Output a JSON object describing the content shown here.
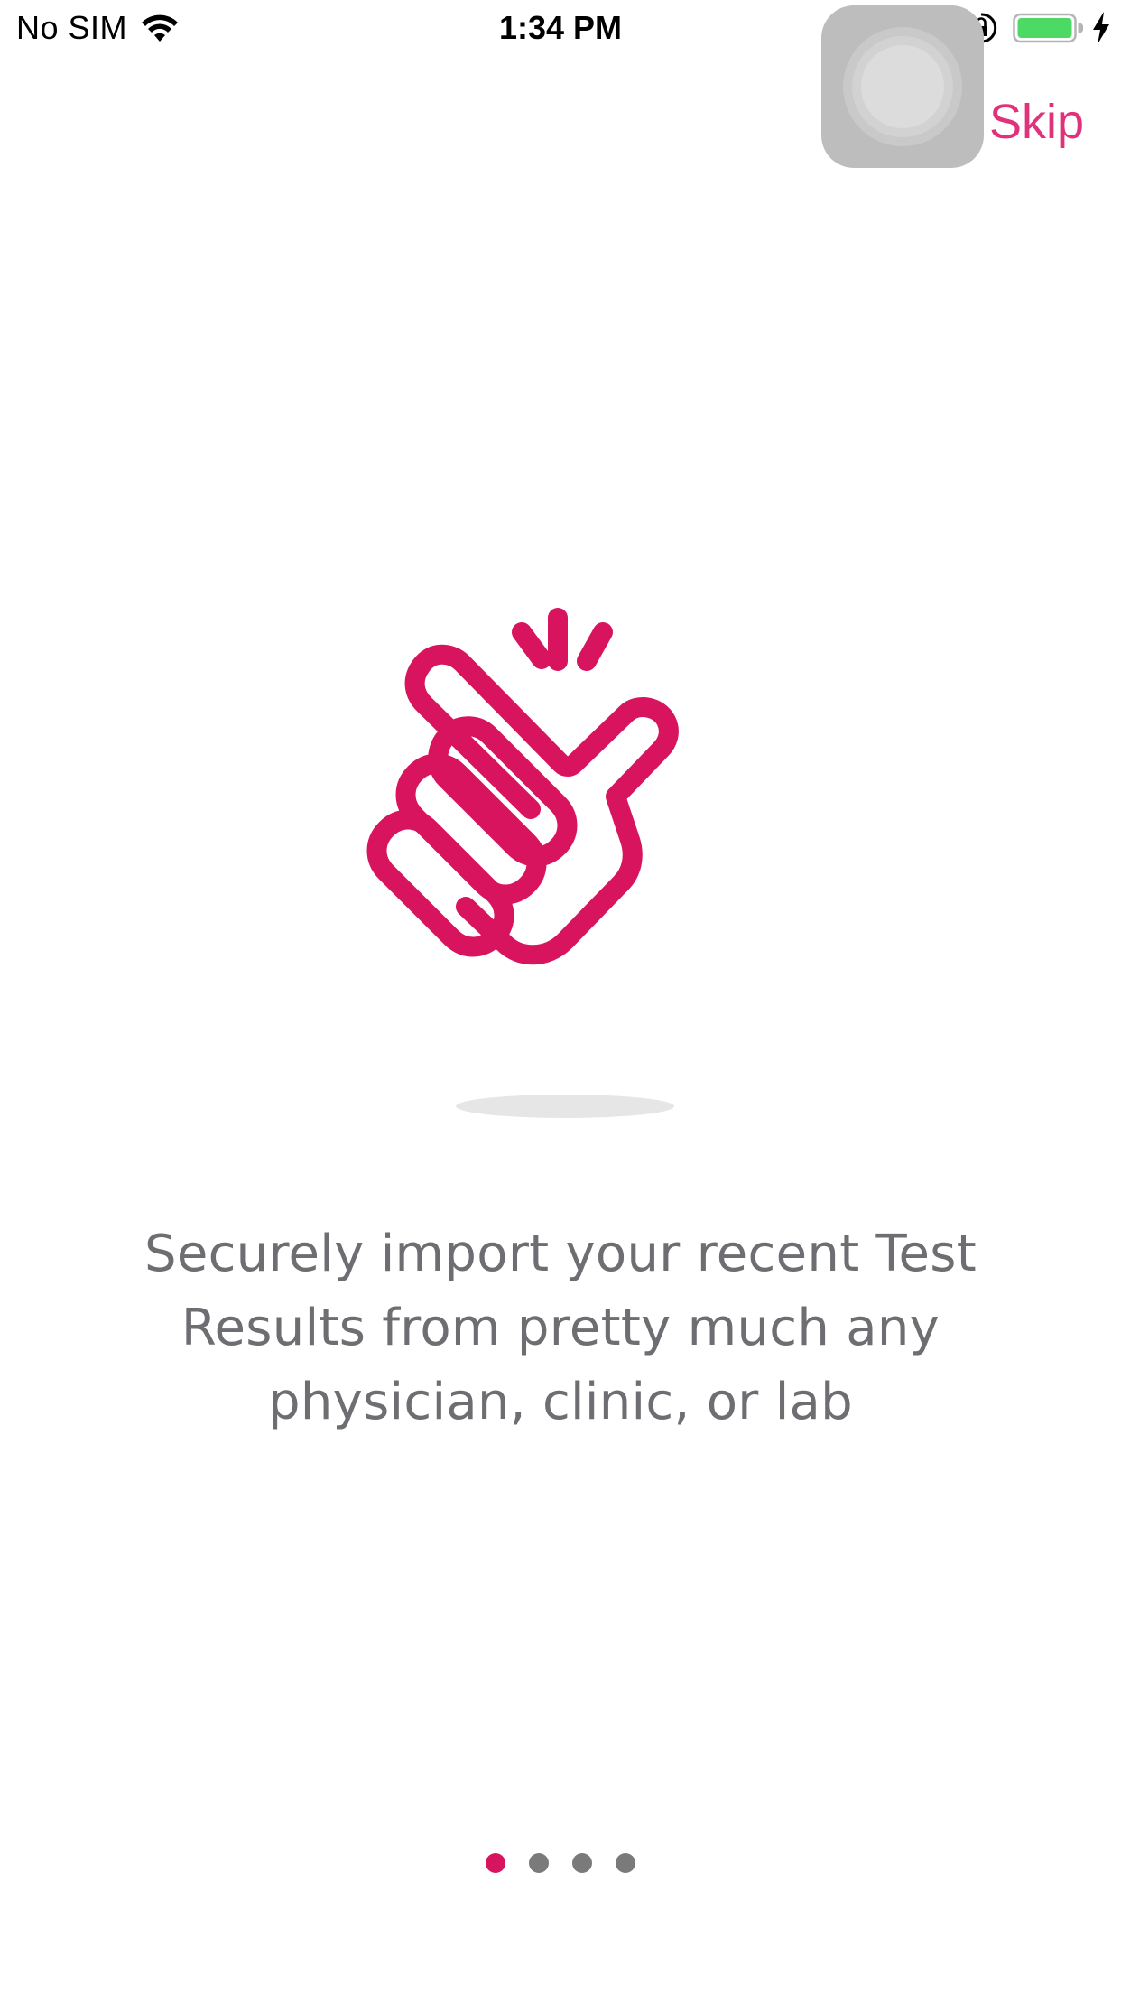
{
  "status_bar": {
    "carrier": "No SIM",
    "time": "1:34 PM",
    "icons": [
      "wifi-icon",
      "lock-rotation-icon",
      "battery-icon",
      "charging-icon"
    ],
    "battery_color": "#4cd964"
  },
  "header": {
    "skip_label": "Skip",
    "skip_color": "#e0327a"
  },
  "illustration": {
    "icon": "finger-snap-icon",
    "color": "#d8145f"
  },
  "onboarding": {
    "description": "Securely import your recent Test Results from pretty much any physician, clinic, or lab"
  },
  "page_indicator": {
    "total": 4,
    "active_index": 0,
    "active_color": "#d8145f",
    "inactive_color": "#7a7a7a"
  }
}
